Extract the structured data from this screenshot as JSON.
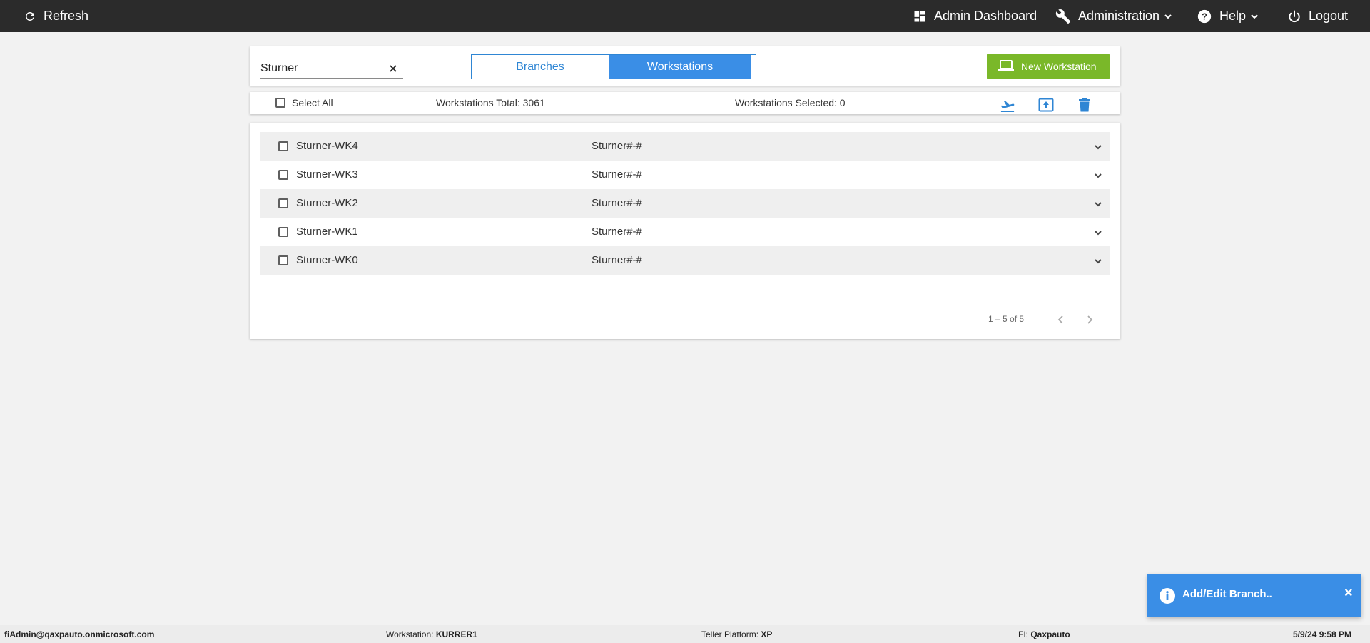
{
  "topbar": {
    "refresh_label": "Refresh",
    "admin_dashboard_label": "Admin Dashboard",
    "administration_label": "Administration",
    "help_label": "Help",
    "logout_label": "Logout"
  },
  "search": {
    "value": "Sturner",
    "placeholder": ""
  },
  "view_toggle": {
    "branches_label": "Branches",
    "workstations_label": "Workstations",
    "active": "Workstations"
  },
  "new_workstation_label": "New Workstation",
  "summary": {
    "select_all_label": "Select All",
    "total_label": "Workstations Total: 3061",
    "selected_label": "Workstations Selected: 0"
  },
  "icons": {
    "transfer": "airplane-departure-icon",
    "upload": "upload-box-icon",
    "delete": "trash-icon",
    "accent": "#2f86d4"
  },
  "workstations": [
    {
      "name": "Sturner-WK4",
      "branch": "Sturner#-#"
    },
    {
      "name": "Sturner-WK3",
      "branch": "Sturner#-#"
    },
    {
      "name": "Sturner-WK2",
      "branch": "Sturner#-#"
    },
    {
      "name": "Sturner-WK1",
      "branch": "Sturner#-#"
    },
    {
      "name": "Sturner-WK0",
      "branch": "Sturner#-#"
    }
  ],
  "pagination": {
    "range_label": "1 – 5 of 5"
  },
  "toast": {
    "message": "Add/Edit Branch..",
    "close_glyph": "×"
  },
  "statusbar": {
    "user": "fiAdmin@qaxpauto.onmicrosoft.com",
    "workstation_label": "Workstation:",
    "workstation_value": "KURRER1",
    "platform_label": "Teller Platform:",
    "platform_value": "XP",
    "fi_label": "FI:",
    "fi_value": "Qaxpauto",
    "datetime": "5/9/24 9:58 PM"
  },
  "colors": {
    "topbar_bg": "#2b2b2b",
    "primary_blue": "#3a8ee6",
    "green": "#7ab829",
    "page_bg": "#f2f2f2"
  }
}
